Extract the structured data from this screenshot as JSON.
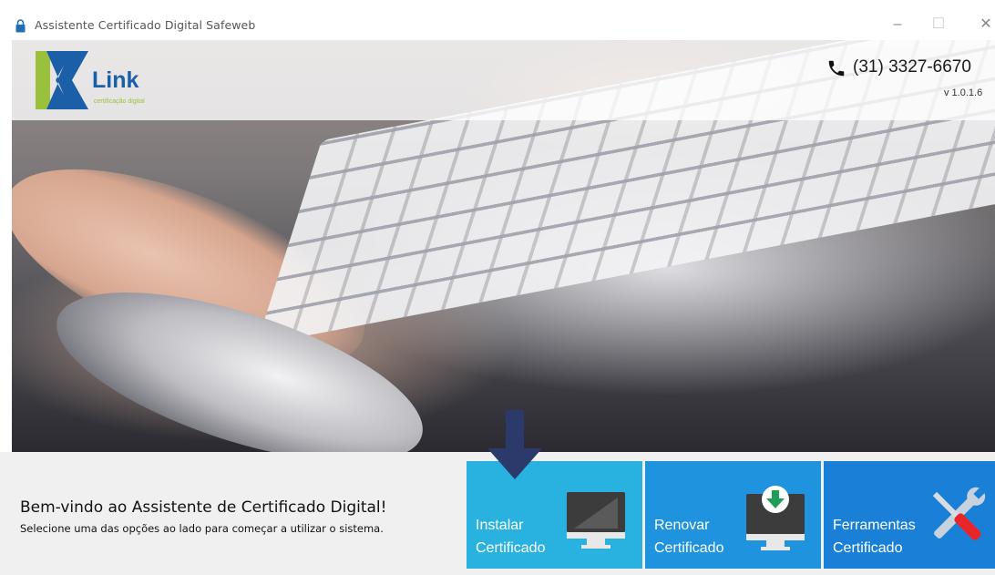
{
  "window": {
    "title": "Assistente Certificado Digital Safeweb",
    "minimize": "–",
    "maximize": "☐",
    "close": "✕"
  },
  "header": {
    "logo_name": "Link",
    "logo_tagline": "certificação digital",
    "phone": "(31) 3327-6670",
    "version": "v 1.0.1.6"
  },
  "footer": {
    "welcome_title": "Bem-vindo ao Assistente de Certificado Digital!",
    "welcome_subtitle": "Selecione uma das opções ao lado para começar a utilizar o sistema."
  },
  "tiles": [
    {
      "line1": "Instalar",
      "line2": "Certificado",
      "icon": "monitor-icon"
    },
    {
      "line1": "Renovar",
      "line2": "Certificado",
      "icon": "monitor-download-icon"
    },
    {
      "line1": "Ferramentas",
      "line2": "Certificado",
      "icon": "tools-icon"
    }
  ],
  "colors": {
    "tile_install": "#29b2df",
    "tile_renew": "#1f93dd",
    "tile_tools": "#1a7fd6",
    "logo_blue": "#1b5fa8",
    "logo_green": "#9bc13c",
    "arrow": "#2c3a6b"
  }
}
